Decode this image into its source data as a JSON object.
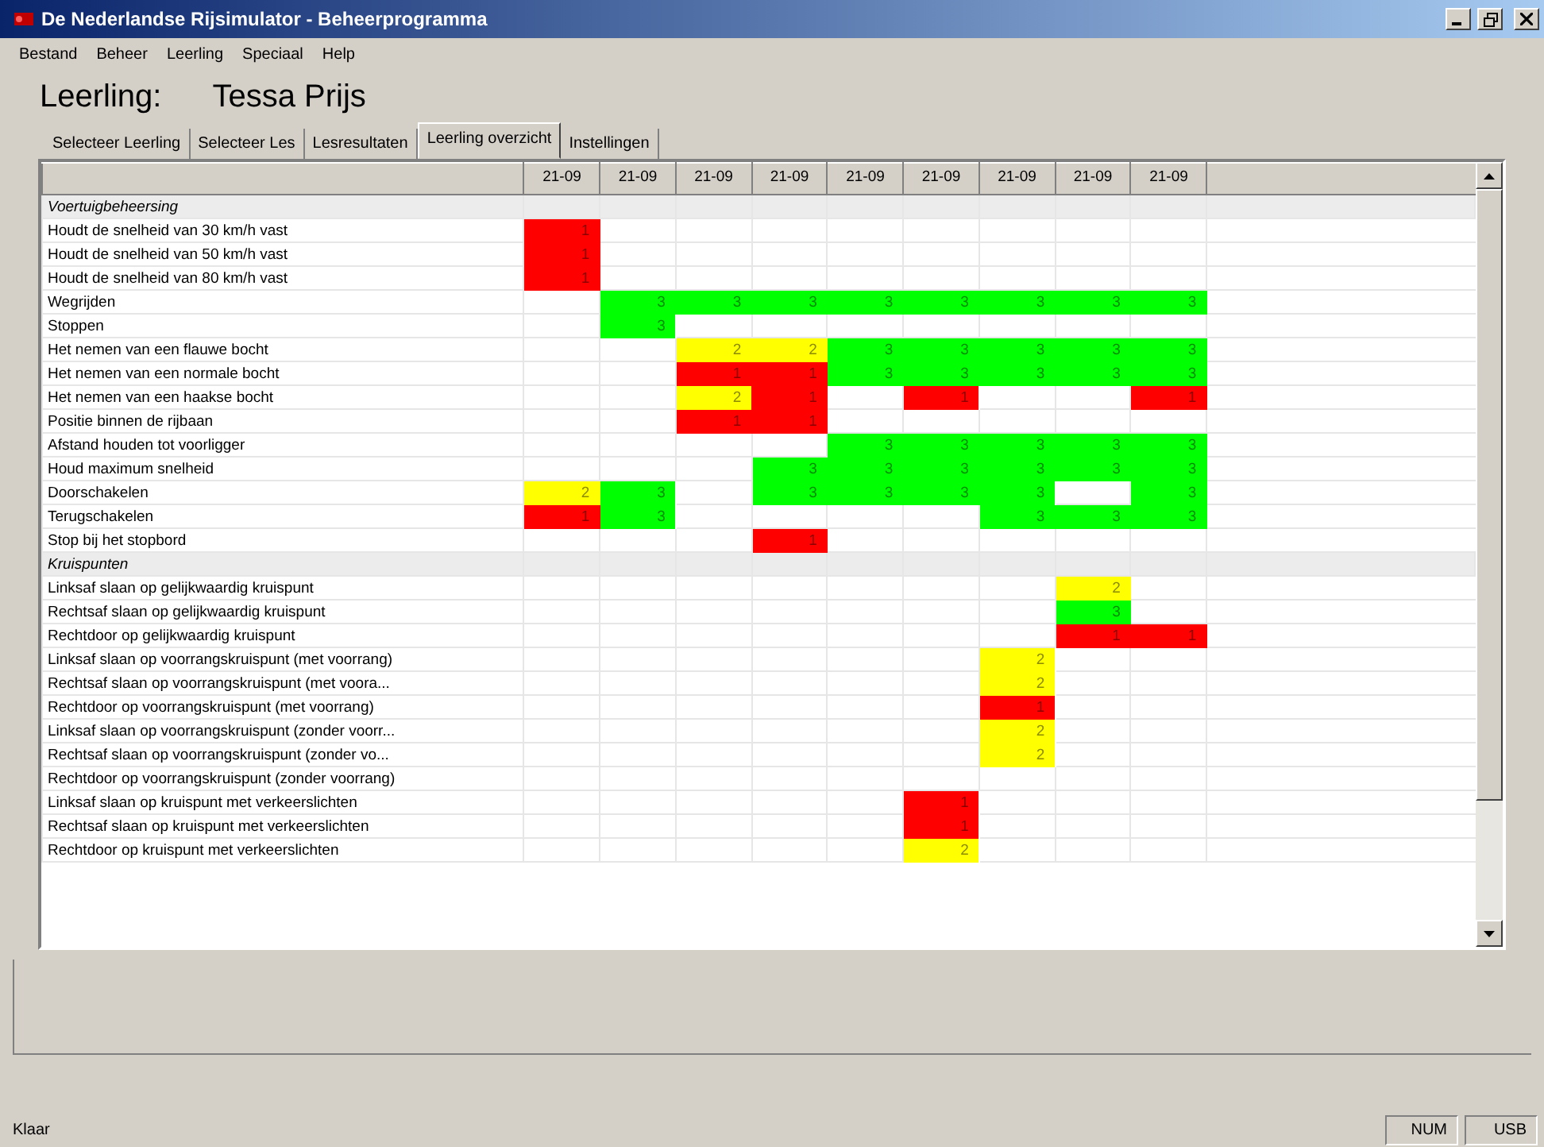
{
  "window": {
    "title": "De Nederlandse Rijsimulator - Beheerprogramma"
  },
  "menu": [
    "Bestand",
    "Beheer",
    "Leerling",
    "Speciaal",
    "Help"
  ],
  "student": {
    "label": "Leerling:",
    "name": "Tessa Prijs"
  },
  "tabs": [
    {
      "label": "Selecteer Leerling",
      "selected": false
    },
    {
      "label": "Selecteer Les",
      "selected": false
    },
    {
      "label": "Lesresultaten",
      "selected": false
    },
    {
      "label": "Leerling overzicht",
      "selected": true
    },
    {
      "label": "Instellingen",
      "selected": false
    }
  ],
  "grid": {
    "columns": [
      "21-09",
      "21-09",
      "21-09",
      "21-09",
      "21-09",
      "21-09",
      "21-09",
      "21-09",
      "21-09"
    ],
    "rows": [
      {
        "kind": "section",
        "label": "Voertuigbeheersing"
      },
      {
        "kind": "item",
        "label": "Houdt de snelheid van 30 km/h vast",
        "cells": [
          {
            "value": "1",
            "color": "#ff0000"
          },
          null,
          null,
          null,
          null,
          null,
          null,
          null,
          null
        ]
      },
      {
        "kind": "item",
        "label": "Houdt de snelheid van 50 km/h vast",
        "cells": [
          {
            "value": "1",
            "color": "#ff0000"
          },
          null,
          null,
          null,
          null,
          null,
          null,
          null,
          null
        ]
      },
      {
        "kind": "item",
        "label": "Houdt de snelheid van 80 km/h vast",
        "cells": [
          {
            "value": "1",
            "color": "#ff0000"
          },
          null,
          null,
          null,
          null,
          null,
          null,
          null,
          null
        ]
      },
      {
        "kind": "item",
        "label": "Wegrijden",
        "cells": [
          null,
          {
            "value": "3",
            "color": "#00ff00"
          },
          {
            "value": "3",
            "color": "#00ff00"
          },
          {
            "value": "3",
            "color": "#00ff00"
          },
          {
            "value": "3",
            "color": "#00ff00"
          },
          {
            "value": "3",
            "color": "#00ff00"
          },
          {
            "value": "3",
            "color": "#00ff00"
          },
          {
            "value": "3",
            "color": "#00ff00"
          },
          {
            "value": "3",
            "color": "#00ff00"
          }
        ]
      },
      {
        "kind": "item",
        "label": "Stoppen",
        "cells": [
          null,
          {
            "value": "3",
            "color": "#00ff00"
          },
          null,
          null,
          null,
          null,
          null,
          null,
          null
        ]
      },
      {
        "kind": "item",
        "label": "Het nemen van een flauwe bocht",
        "cells": [
          null,
          null,
          {
            "value": "2",
            "color": "#ffff00"
          },
          {
            "value": "2",
            "color": "#ffff00"
          },
          {
            "value": "3",
            "color": "#00ff00"
          },
          {
            "value": "3",
            "color": "#00ff00"
          },
          {
            "value": "3",
            "color": "#00ff00"
          },
          {
            "value": "3",
            "color": "#00ff00"
          },
          {
            "value": "3",
            "color": "#00ff00"
          }
        ]
      },
      {
        "kind": "item",
        "label": "Het nemen van een normale bocht",
        "cells": [
          null,
          null,
          {
            "value": "1",
            "color": "#ff0000"
          },
          {
            "value": "1",
            "color": "#ff0000"
          },
          {
            "value": "3",
            "color": "#00ff00"
          },
          {
            "value": "3",
            "color": "#00ff00"
          },
          {
            "value": "3",
            "color": "#00ff00"
          },
          {
            "value": "3",
            "color": "#00ff00"
          },
          {
            "value": "3",
            "color": "#00ff00"
          }
        ]
      },
      {
        "kind": "item",
        "label": "Het nemen van een haakse bocht",
        "cells": [
          null,
          null,
          {
            "value": "2",
            "color": "#ffff00"
          },
          {
            "value": "1",
            "color": "#ff0000"
          },
          null,
          {
            "value": "1",
            "color": "#ff0000"
          },
          null,
          null,
          {
            "value": "1",
            "color": "#ff0000"
          }
        ]
      },
      {
        "kind": "item",
        "label": "Positie binnen de rijbaan",
        "cells": [
          null,
          null,
          {
            "value": "1",
            "color": "#ff0000"
          },
          {
            "value": "1",
            "color": "#ff0000"
          },
          null,
          null,
          null,
          null,
          null
        ]
      },
      {
        "kind": "item",
        "label": "Afstand houden tot voorligger",
        "cells": [
          null,
          null,
          null,
          null,
          {
            "value": "3",
            "color": "#00ff00"
          },
          {
            "value": "3",
            "color": "#00ff00"
          },
          {
            "value": "3",
            "color": "#00ff00"
          },
          {
            "value": "3",
            "color": "#00ff00"
          },
          {
            "value": "3",
            "color": "#00ff00"
          }
        ]
      },
      {
        "kind": "item",
        "label": "Houd maximum snelheid",
        "cells": [
          null,
          null,
          null,
          {
            "value": "3",
            "color": "#00ff00"
          },
          {
            "value": "3",
            "color": "#00ff00"
          },
          {
            "value": "3",
            "color": "#00ff00"
          },
          {
            "value": "3",
            "color": "#00ff00"
          },
          {
            "value": "3",
            "color": "#00ff00"
          },
          {
            "value": "3",
            "color": "#00ff00"
          }
        ]
      },
      {
        "kind": "item",
        "label": "Doorschakelen",
        "cells": [
          {
            "value": "2",
            "color": "#ffff00"
          },
          {
            "value": "3",
            "color": "#00ff00"
          },
          null,
          {
            "value": "3",
            "color": "#00ff00"
          },
          {
            "value": "3",
            "color": "#00ff00"
          },
          {
            "value": "3",
            "color": "#00ff00"
          },
          {
            "value": "3",
            "color": "#00ff00"
          },
          null,
          {
            "value": "3",
            "color": "#00ff00"
          }
        ]
      },
      {
        "kind": "item",
        "label": "Terugschakelen",
        "cells": [
          {
            "value": "1",
            "color": "#ff0000"
          },
          {
            "value": "3",
            "color": "#00ff00"
          },
          null,
          null,
          null,
          null,
          {
            "value": "3",
            "color": "#00ff00"
          },
          {
            "value": "3",
            "color": "#00ff00"
          },
          {
            "value": "3",
            "color": "#00ff00"
          }
        ]
      },
      {
        "kind": "item",
        "label": "Stop bij het stopbord",
        "cells": [
          null,
          null,
          null,
          {
            "value": "1",
            "color": "#ff0000"
          },
          null,
          null,
          null,
          null,
          null
        ]
      },
      {
        "kind": "section",
        "label": "Kruispunten"
      },
      {
        "kind": "item",
        "label": "Linksaf slaan op gelijkwaardig kruispunt",
        "cells": [
          null,
          null,
          null,
          null,
          null,
          null,
          null,
          {
            "value": "2",
            "color": "#ffff00"
          },
          null
        ]
      },
      {
        "kind": "item",
        "label": "Rechtsaf slaan op gelijkwaardig kruispunt",
        "cells": [
          null,
          null,
          null,
          null,
          null,
          null,
          null,
          {
            "value": "3",
            "color": "#00ff00"
          },
          null
        ]
      },
      {
        "kind": "item",
        "label": "Rechtdoor op gelijkwaardig kruispunt",
        "cells": [
          null,
          null,
          null,
          null,
          null,
          null,
          null,
          {
            "value": "1",
            "color": "#ff0000"
          },
          {
            "value": "1",
            "color": "#ff0000"
          }
        ]
      },
      {
        "kind": "item",
        "label": "Linksaf slaan op voorrangskruispunt (met voorrang)",
        "cells": [
          null,
          null,
          null,
          null,
          null,
          null,
          {
            "value": "2",
            "color": "#ffff00"
          },
          null,
          null
        ]
      },
      {
        "kind": "item",
        "label": "Rechtsaf slaan op voorrangskruispunt (met voora...",
        "cells": [
          null,
          null,
          null,
          null,
          null,
          null,
          {
            "value": "2",
            "color": "#ffff00"
          },
          null,
          null
        ]
      },
      {
        "kind": "item",
        "label": "Rechtdoor op voorrangskruispunt (met voorrang)",
        "cells": [
          null,
          null,
          null,
          null,
          null,
          null,
          {
            "value": "1",
            "color": "#ff0000"
          },
          null,
          null
        ]
      },
      {
        "kind": "item",
        "label": "Linksaf slaan op voorrangskruispunt (zonder voorr...",
        "cells": [
          null,
          null,
          null,
          null,
          null,
          null,
          {
            "value": "2",
            "color": "#ffff00"
          },
          null,
          null
        ]
      },
      {
        "kind": "item",
        "label": "Rechtsaf slaan op voorrangskruispunt (zonder vo...",
        "cells": [
          null,
          null,
          null,
          null,
          null,
          null,
          {
            "value": "2",
            "color": "#ffff00"
          },
          null,
          null
        ]
      },
      {
        "kind": "item",
        "label": "Rechtdoor op voorrangskruispunt (zonder voorrang)",
        "cells": [
          null,
          null,
          null,
          null,
          null,
          null,
          null,
          null,
          null
        ]
      },
      {
        "kind": "item",
        "label": "Linksaf slaan op kruispunt met verkeerslichten",
        "cells": [
          null,
          null,
          null,
          null,
          null,
          {
            "value": "1",
            "color": "#ff0000"
          },
          null,
          null,
          null
        ]
      },
      {
        "kind": "item",
        "label": "Rechtsaf slaan op kruispunt met verkeerslichten",
        "cells": [
          null,
          null,
          null,
          null,
          null,
          {
            "value": "1",
            "color": "#ff0000"
          },
          null,
          null,
          null
        ]
      },
      {
        "kind": "item",
        "label": "Rechtdoor op kruispunt met verkeerslichten",
        "cells": [
          null,
          null,
          null,
          null,
          null,
          {
            "value": "2",
            "color": "#ffff00"
          },
          null,
          null,
          null
        ]
      }
    ]
  },
  "status_bar": {
    "text": "Klaar",
    "panels": [
      "NUM",
      "USB"
    ]
  }
}
